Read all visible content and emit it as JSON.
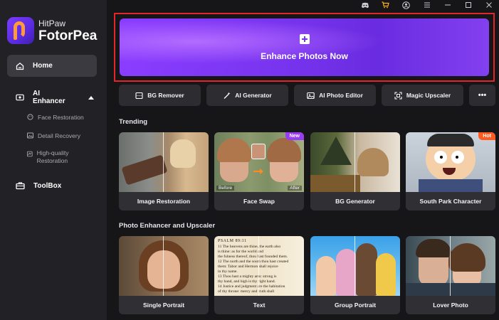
{
  "app": {
    "brand_line1": "HitPaw",
    "brand_line2": "FotorPea"
  },
  "window_controls": [
    "discord-icon",
    "cart-icon",
    "account-icon",
    "menu-icon",
    "minimize-icon",
    "maximize-icon",
    "close-icon"
  ],
  "sidebar": {
    "home": "Home",
    "ai_enhancer": "AI Enhancer",
    "sub_items": [
      "Face Restoration",
      "Detail Recovery",
      "High-quality Restoration"
    ],
    "toolbox": "ToolBox"
  },
  "hero": {
    "label": "Enhance Photos Now"
  },
  "tools": [
    {
      "label": "BG Remover",
      "icon": "bg-remover-icon"
    },
    {
      "label": "AI Generator",
      "icon": "magic-wand-icon"
    },
    {
      "label": "AI Photo Editor",
      "icon": "photo-editor-icon"
    },
    {
      "label": "Magic Upscaler",
      "icon": "upscale-icon"
    },
    {
      "label": "•••",
      "icon": "more-icon"
    }
  ],
  "trending": {
    "title": "Trending",
    "cards": [
      {
        "label": "Image Restoration"
      },
      {
        "label": "Face Swap",
        "badge": "New",
        "before": "Before",
        "after": "After"
      },
      {
        "label": "BG Generator"
      },
      {
        "label": "South Park Character",
        "badge": "Hot"
      }
    ]
  },
  "enhancer": {
    "title": "Photo Enhancer and Upscaler",
    "cards": [
      {
        "label": "Single Portrait"
      },
      {
        "label": "Text",
        "doc_header": "PSALM 89:11",
        "doc_lines": [
          "11 The heavens are thine, the earth also",
          "is thine: as for the world and",
          "the fulness thereof, thou hast founded them.",
          "12 The north and the south thou hast created",
          "them: Tabor and Hermon shall rejoice",
          "in thy name.",
          "13 Thou hast a mighty arm: strong is",
          "thy hand, and high is thy right hand.",
          "14 Justice and judgment are the habitation",
          "of thy throne: mercy and truth shall"
        ]
      },
      {
        "label": "Group Portrait"
      },
      {
        "label": "Lover Photo"
      }
    ]
  },
  "colors": {
    "accent": "#7a35f0",
    "highlight_border": "#e3262a",
    "new_badge": "#9b3cf5",
    "hot_badge": "#ff5a1f"
  }
}
